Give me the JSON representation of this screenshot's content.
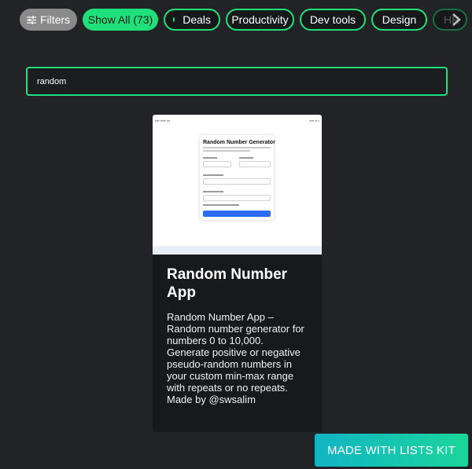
{
  "filters": {
    "filters_label": "Filters",
    "filters_icon": "sliders-icon",
    "show_all_label": "Show All (73)",
    "categories": [
      "Deals",
      "Productivity",
      "Dev tools",
      "Design",
      "HR"
    ],
    "next_icon": "chevron-right-icon"
  },
  "search": {
    "value": "random"
  },
  "card": {
    "title": "Random Number App",
    "description": "Random Number App – Random number generator for numbers 0 to 10,000. Generate positive or negative pseudo-random numbers in your custom min-max range with repeats or no repeats. Made by @swsalim",
    "thumbnail": {
      "heading": "Random Number Generator"
    }
  },
  "footer": {
    "made_with_label": "MADE WITH LISTS KIT"
  },
  "colors": {
    "accent": "#1fe07a",
    "background": "#222326",
    "card": "#18191b"
  }
}
